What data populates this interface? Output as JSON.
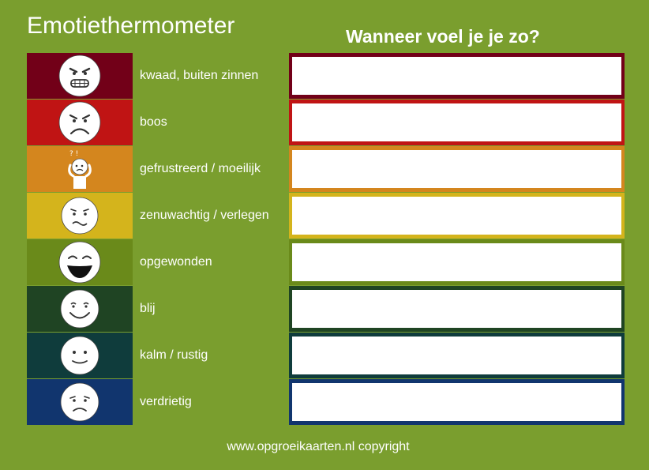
{
  "title": "Emotiethermometer",
  "subtitle": "Wanneer voel je je zo?",
  "footer": "www.opgroeikaarten.nl copyright",
  "colors": {
    "background": "#7a9e2e",
    "answer_box": "#ffffff"
  },
  "emotions": [
    {
      "label": "kwaad, buiten zinnen",
      "color": "#720018",
      "icon": "angry-face-icon"
    },
    {
      "label": "boos",
      "color": "#c01414",
      "icon": "frowning-face-icon"
    },
    {
      "label": "gefrustreerd / moeilijk",
      "color": "#d4861e",
      "icon": "frustrated-person-icon"
    },
    {
      "label": "zenuwachtig / verlegen",
      "color": "#d4b41c",
      "icon": "nervous-face-icon"
    },
    {
      "label": "opgewonden",
      "color": "#6a8a1a",
      "icon": "excited-face-icon"
    },
    {
      "label": "blij",
      "color": "#1f4423",
      "icon": "happy-face-icon"
    },
    {
      "label": "kalm / rustig",
      "color": "#0f3c3c",
      "icon": "calm-face-icon"
    },
    {
      "label": "verdrietig",
      "color": "#11356e",
      "icon": "sad-face-icon"
    }
  ]
}
